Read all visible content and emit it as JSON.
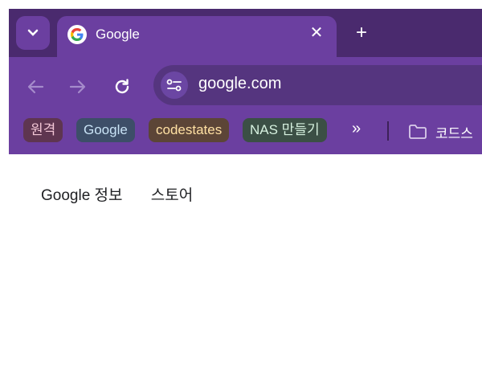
{
  "tab": {
    "title": "Google"
  },
  "address_bar": {
    "url": "google.com"
  },
  "bookmarks": [
    {
      "label": "원격"
    },
    {
      "label": "Google"
    },
    {
      "label": "codestates"
    },
    {
      "label": "NAS 만들기"
    }
  ],
  "bookmark_folder": {
    "label": "코드스"
  },
  "overflow_label": "»",
  "page": {
    "links": [
      {
        "label": "Google 정보"
      },
      {
        "label": "스토어"
      }
    ]
  },
  "colors": {
    "frame": "#4a2a6e",
    "toolbar": "#6b3fa0",
    "omnibox": "#55357f"
  }
}
